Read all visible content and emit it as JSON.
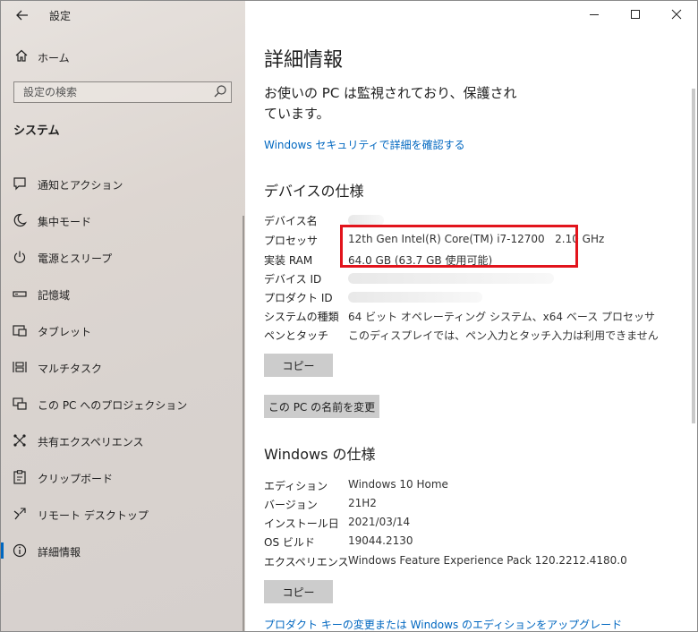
{
  "app": {
    "title": "設定",
    "back_icon": "back-arrow-icon"
  },
  "sidebar": {
    "home_label": "ホーム",
    "search_placeholder": "設定の検索",
    "section_title": "システム",
    "items": [
      {
        "label": "通知とアクション",
        "icon": "notification-icon"
      },
      {
        "label": "集中モード",
        "icon": "moon-icon"
      },
      {
        "label": "電源とスリープ",
        "icon": "power-icon"
      },
      {
        "label": "記憶域",
        "icon": "storage-icon"
      },
      {
        "label": "タブレット",
        "icon": "tablet-icon"
      },
      {
        "label": "マルチタスク",
        "icon": "multitask-icon"
      },
      {
        "label": "この PC へのプロジェクション",
        "icon": "projection-icon"
      },
      {
        "label": "共有エクスペリエンス",
        "icon": "shared-experience-icon"
      },
      {
        "label": "クリップボード",
        "icon": "clipboard-icon"
      },
      {
        "label": "リモート デスクトップ",
        "icon": "remote-desktop-icon"
      },
      {
        "label": "詳細情報",
        "icon": "info-icon",
        "active": true
      }
    ]
  },
  "main": {
    "title": "詳細情報",
    "protection_text": "お使いの PC は監視されており、保護されています。",
    "security_link": "Windows セキュリティで詳細を確認する",
    "device_specs": {
      "heading": "デバイスの仕様",
      "rows": [
        {
          "label": "デバイス名",
          "value": ""
        },
        {
          "label": "プロセッサ",
          "value": "12th Gen Intel(R) Core(TM) i7-12700   2.10 GHz"
        },
        {
          "label": "実装 RAM",
          "value": "64.0 GB (63.7 GB 使用可能)"
        },
        {
          "label": "デバイス ID",
          "value": ""
        },
        {
          "label": "プロダクト ID",
          "value": ""
        },
        {
          "label": "システムの種類",
          "value": "64 ビット オペレーティング システム、x64 ベース プロセッサ"
        },
        {
          "label": "ペンとタッチ",
          "value": "このディスプレイでは、ペン入力とタッチ入力は利用できません"
        }
      ],
      "copy_button": "コピー",
      "rename_button": "この PC の名前を変更"
    },
    "windows_specs": {
      "heading": "Windows の仕様",
      "rows": [
        {
          "label": "エディション",
          "value": "Windows 10 Home"
        },
        {
          "label": "バージョン",
          "value": "21H2"
        },
        {
          "label": "インストール日",
          "value": "2021/03/14"
        },
        {
          "label": "OS ビルド",
          "value": "19044.2130"
        },
        {
          "label": "エクスペリエンス",
          "value": "Windows Feature Experience Pack 120.2212.4180.0"
        }
      ],
      "copy_button": "コピー"
    },
    "product_key_link": "プロダクト キーの変更または Windows のエディションをアップグレード"
  },
  "colors": {
    "accent": "#0067c0",
    "highlight_border": "#e2141c",
    "button_bg": "#cccccc"
  }
}
